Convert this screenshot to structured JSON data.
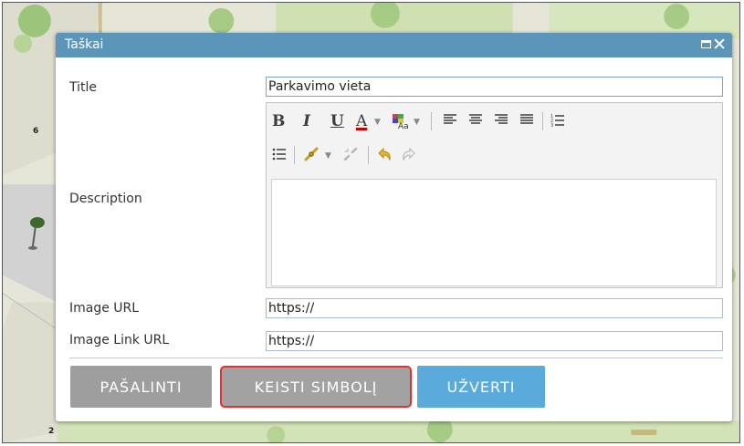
{
  "map": {
    "labels": [
      "6",
      "2"
    ]
  },
  "dialog": {
    "title": "Taškai",
    "maximize_icon": "maximize-icon",
    "close_icon": "close-icon",
    "title_bar_color": "#5b96ba"
  },
  "form": {
    "title_label": "Title",
    "title_value": "Parkavimo vieta",
    "description_label": "Description",
    "image_url_label": "Image URL",
    "image_url_value": "https://",
    "image_link_label": "Image Link URL",
    "image_link_value": "https://"
  },
  "toolbar": {
    "bold": "B",
    "italic": "I",
    "underline": "U",
    "font_color": "A",
    "icons": [
      "bold-icon",
      "italic-icon",
      "underline-icon",
      "font-color-icon",
      "highlight-color-icon",
      "align-left-icon",
      "align-center-icon",
      "align-right-icon",
      "justify-icon",
      "numbered-list-icon",
      "bulleted-list-icon",
      "link-icon",
      "unlink-icon",
      "undo-icon",
      "redo-icon"
    ]
  },
  "buttons": {
    "delete": "PAŠALINTI",
    "change_symbol": "KEISTI SIMBOLĮ",
    "close": "UŽVERTI"
  },
  "colors": {
    "close_button": "#5aabdb",
    "gray_button": "#9e9e9e",
    "highlight_border": "#e43030"
  }
}
